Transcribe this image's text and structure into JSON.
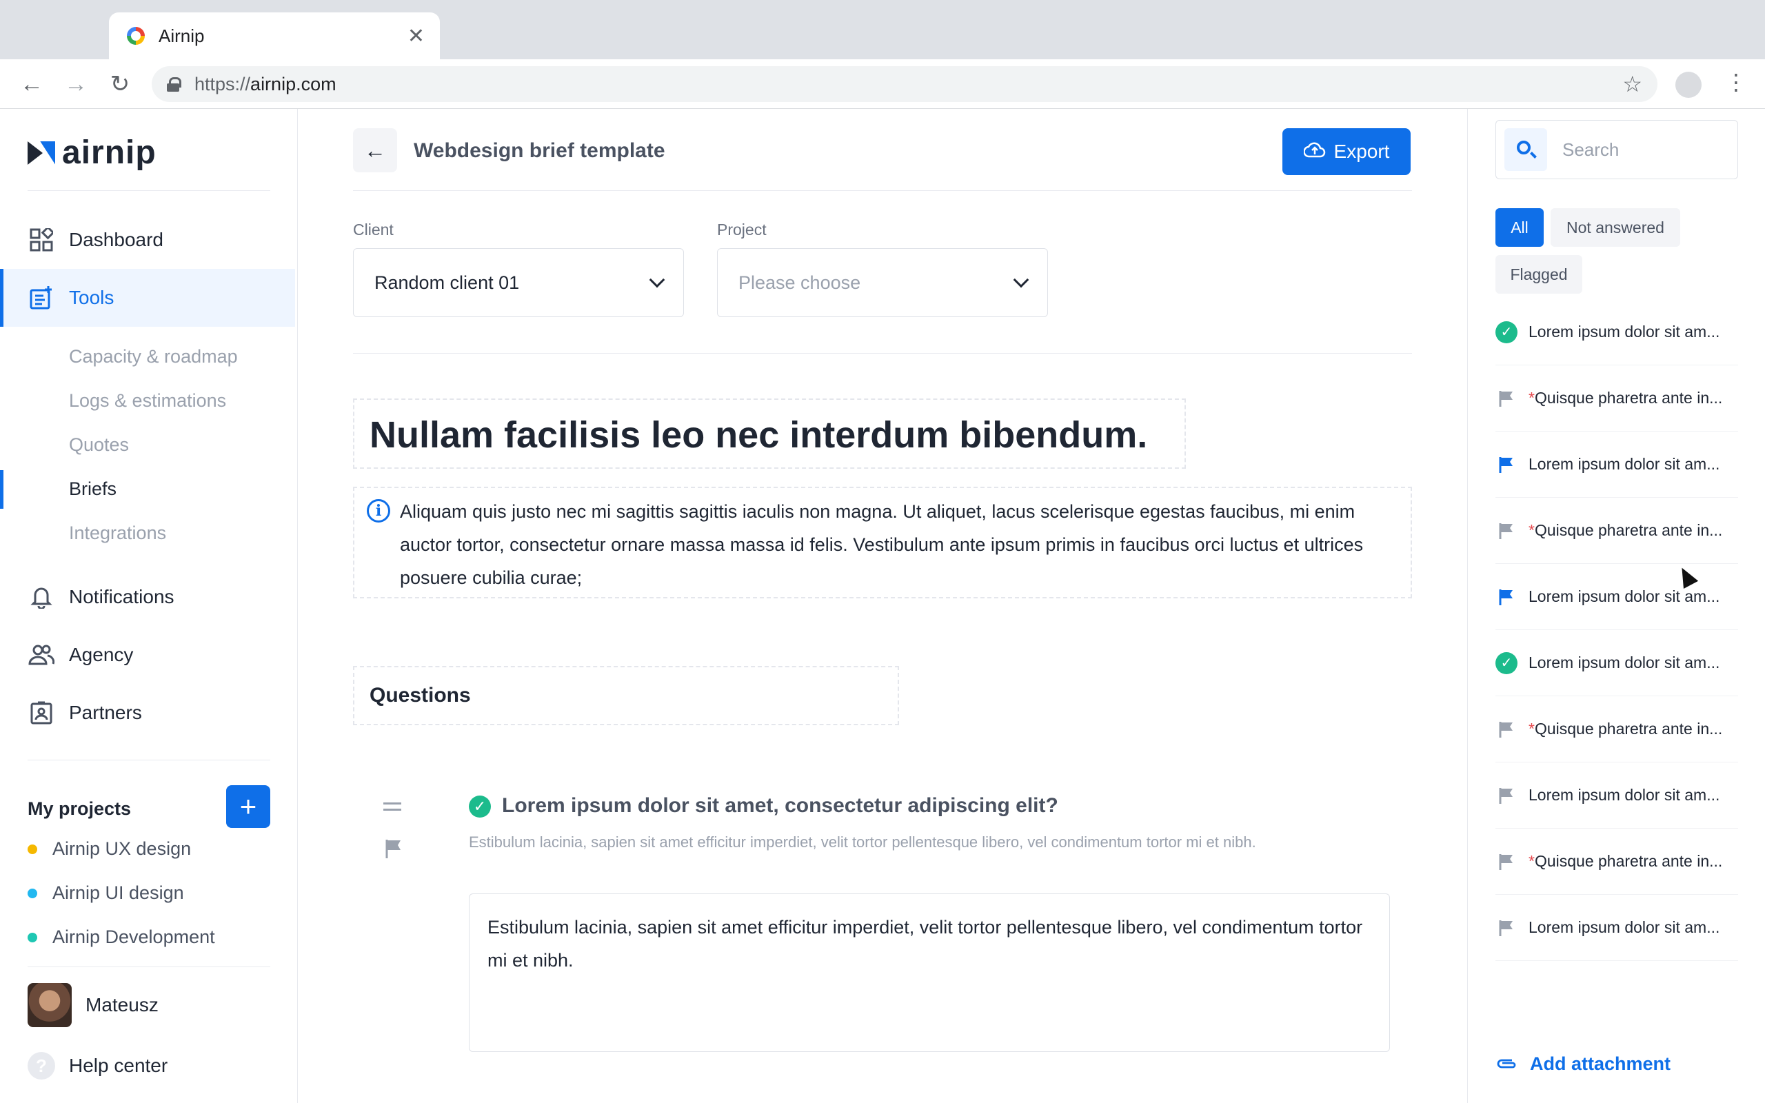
{
  "browser": {
    "tab_title": "Airnip",
    "tab_close": "✕",
    "url_prefix": "https://",
    "url_host": "airnip.com",
    "back": "←",
    "forward": "→",
    "reload": "↻",
    "bookmark": "☆",
    "menu": "⋮"
  },
  "sidebar": {
    "logo_text": "airnip",
    "nav": [
      {
        "label": "Dashboard",
        "icon": "dashboard-icon"
      },
      {
        "label": "Tools",
        "icon": "tools-icon"
      }
    ],
    "tools_sub": [
      "Capacity & roadmap",
      "Logs & estimations",
      "Quotes",
      "Briefs",
      "Integrations"
    ],
    "nav2": [
      {
        "label": "Notifications",
        "icon": "bell-icon"
      },
      {
        "label": "Agency",
        "icon": "users-icon"
      },
      {
        "label": "Partners",
        "icon": "id-card-icon"
      }
    ],
    "projects_title": "My projects",
    "add_project": "+",
    "projects": [
      {
        "label": "Airnip UX design",
        "color": "#f5b800"
      },
      {
        "label": "Airnip UI design",
        "color": "#22b8f0"
      },
      {
        "label": "Airnip Development",
        "color": "#1fc7b3"
      }
    ],
    "user_name": "Mateusz",
    "help_label": "Help center",
    "help_icon": "?"
  },
  "main": {
    "back_icon": "←",
    "title": "Webdesign brief template",
    "export_label": "Export",
    "client_label": "Client",
    "client_value": "Random client 01",
    "project_label": "Project",
    "project_placeholder": "Please choose",
    "heading": "Nullam facilisis leo nec interdum bibendum.",
    "info_icon": "i",
    "description": "Aliquam quis justo nec mi sagittis sagittis iaculis non magna. Ut aliquet, lacus scelerisque egestas faucibus, mi enim auctor tortor, consectetur ornare massa massa id felis. Vestibulum ante ipsum primis in faucibus orci luctus et ultrices posuere cubilia curae;",
    "questions_title": "Questions",
    "question": {
      "title": "Lorem ipsum dolor sit amet, consectetur adipiscing elit?",
      "subtitle": "Estibulum lacinia, sapien sit amet efficitur imperdiet, velit tortor pellentesque libero, vel condimentum tortor mi et nibh.",
      "answer": "Estibulum lacinia, sapien sit amet efficitur imperdiet, velit tortor pellentesque libero, vel condimentum tortor mi et nibh.",
      "check": "✓"
    }
  },
  "right": {
    "search_placeholder": "Search",
    "filters": [
      "All",
      "Not answered",
      "Flagged"
    ],
    "items": [
      {
        "status": "answered",
        "required": false,
        "text": "Lorem ipsum dolor sit am..."
      },
      {
        "status": "flag-grey",
        "required": true,
        "text": "Quisque pharetra ante in..."
      },
      {
        "status": "flag-blue",
        "required": false,
        "text": "Lorem ipsum dolor sit am..."
      },
      {
        "status": "flag-grey",
        "required": true,
        "text": "Quisque pharetra ante in..."
      },
      {
        "status": "flag-blue",
        "required": false,
        "text": "Lorem ipsum dolor sit am..."
      },
      {
        "status": "answered",
        "required": false,
        "text": "Lorem ipsum dolor sit am..."
      },
      {
        "status": "flag-grey",
        "required": true,
        "text": "Quisque pharetra ante in..."
      },
      {
        "status": "flag-grey",
        "required": false,
        "text": "Lorem ipsum dolor sit am..."
      },
      {
        "status": "flag-grey",
        "required": true,
        "text": "Quisque pharetra ante in..."
      },
      {
        "status": "flag-grey",
        "required": false,
        "text": "Lorem ipsum dolor sit am..."
      }
    ],
    "required_mark": "*",
    "attach_label": "Add attachment"
  },
  "colors": {
    "accent": "#0f6fe8",
    "success": "#1cbb8c",
    "flag_grey": "#9aa1ad"
  }
}
